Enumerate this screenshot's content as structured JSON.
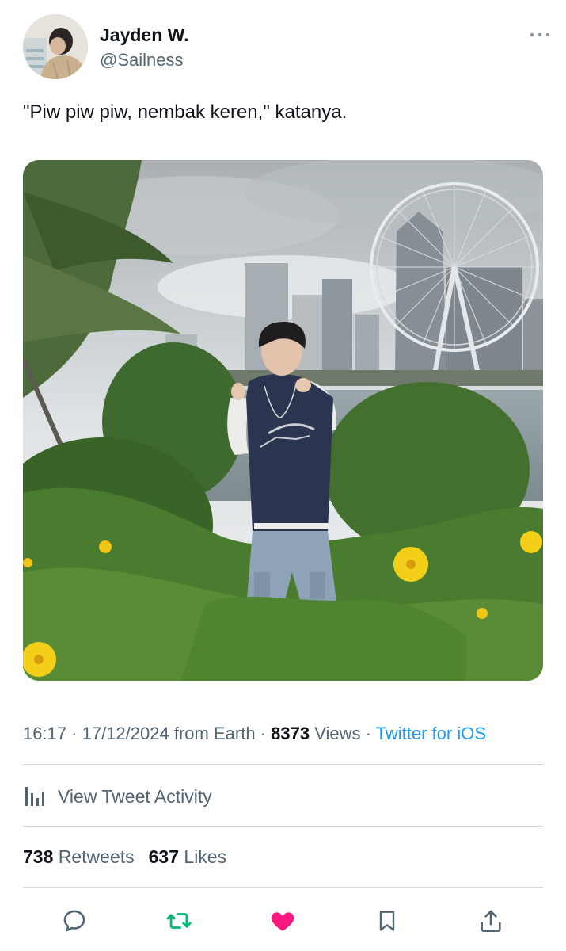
{
  "tweet": {
    "display_name": "Jayden W.",
    "handle": "@Sailness",
    "text": "\"Piw piw piw, nembak keren,\" katanya.",
    "time": "16:17",
    "date": "17/12/2024",
    "location": "from Earth",
    "views_count": "8373",
    "views_label": "Views",
    "source": "Twitter for iOS",
    "separator": " · "
  },
  "activity": {
    "label": "View Tweet Activity"
  },
  "stats": {
    "retweets_count": "738",
    "retweets_label": "Retweets",
    "likes_count": "637",
    "likes_label": "Likes"
  },
  "icons": {
    "avatar": "user-avatar",
    "more": "more-dots-icon",
    "activity": "bar-chart-icon",
    "reply": "reply-icon",
    "retweet": "retweet-icon",
    "like": "heart-icon",
    "bookmark": "bookmark-icon",
    "share": "share-icon"
  },
  "colors": {
    "text": "#0f1419",
    "secondary": "#536471",
    "link": "#1d9bf0",
    "retweet": "#00ba7c",
    "like": "#f91880",
    "divider": "#cfd9de"
  }
}
